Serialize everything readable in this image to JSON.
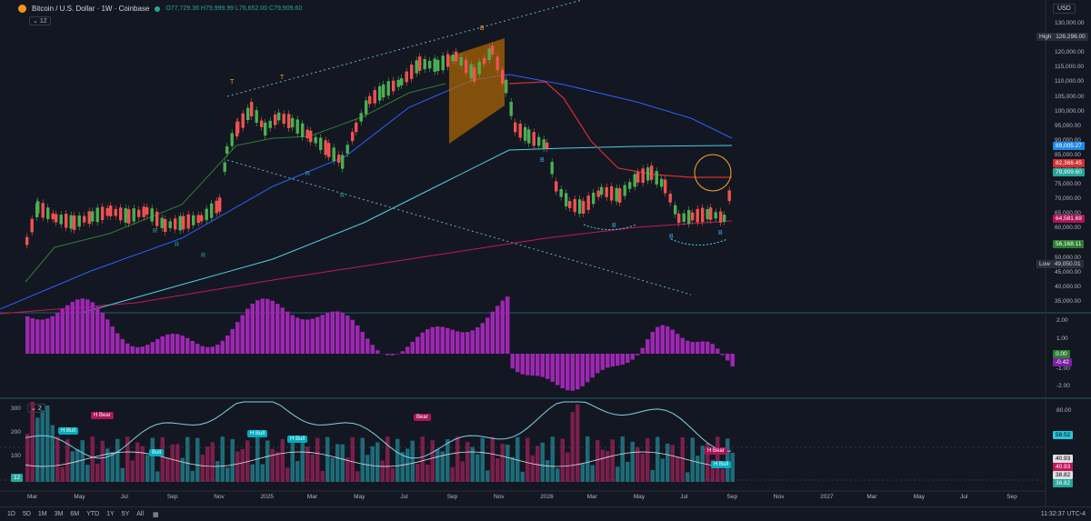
{
  "header": {
    "symbol": "Bitcoin / U.S. Dollar · 1W · Coinbase",
    "ohlc": "O77,729.36 H79,999.99 L76,652.00 C79,909.60",
    "indicator_count": "12",
    "currency": "USD"
  },
  "price_axis": {
    "ticks": [
      "130,000.00",
      "125,000.00",
      "120,000.00",
      "115,000.00",
      "110,000.00",
      "105,000.00",
      "100,000.00",
      "95,000.00",
      "90,000.00",
      "85,000.00",
      "80,000.00",
      "75,000.00",
      "70,000.00",
      "65,000.00",
      "60,000.00",
      "55,000.00",
      "50,000.00",
      "45,000.00",
      "40,000.00",
      "35,000.00"
    ],
    "high_label": "High",
    "high_value": "126,296.00",
    "low_label": "Low",
    "low_value": "49,050.01",
    "tags": [
      "89,005.27",
      "82,366.45",
      "79,909.60",
      "64,581.69",
      "56,168.11"
    ]
  },
  "macd_axis": {
    "ticks": [
      "2.00",
      "1.00",
      "-1.00",
      "-2.00"
    ],
    "tags": [
      "0.00",
      "-0.42"
    ]
  },
  "rsi_panel": {
    "label": "2",
    "left_ticks": [
      "300",
      "200",
      "100"
    ],
    "right_ticks": [
      "80.00"
    ],
    "tags": [
      "58.52",
      "40.93",
      "40.93",
      "38.82",
      "38.82"
    ],
    "left_tag": "12",
    "signals": [
      "H Bull",
      "H Bear",
      "H Bull",
      "Bull",
      "H Bull",
      "Bear",
      "H Bear",
      "H Bull"
    ]
  },
  "time_axis": [
    "Mar",
    "May",
    "Jul",
    "Sep",
    "Nov",
    "2025",
    "Mar",
    "May",
    "Jul",
    "Sep",
    "Nov",
    "2026",
    "Mar",
    "May",
    "Jul",
    "Sep",
    "Nov",
    "2027",
    "Mar",
    "May",
    "Jul",
    "Sep"
  ],
  "chart_labels": [
    "T",
    "T",
    "R",
    "R",
    "R",
    "R",
    "R",
    "B",
    "B",
    "B",
    "B",
    "B"
  ],
  "timebar": {
    "ranges": [
      "1D",
      "5D",
      "1M",
      "3M",
      "6M",
      "YTD",
      "1Y",
      "5Y",
      "All"
    ],
    "clock": "11:32:37 UTC-4"
  },
  "colors": {
    "up": "#26a69a",
    "down": "#ef5350",
    "macd": "#9c27b0",
    "bg": "#131722"
  }
}
